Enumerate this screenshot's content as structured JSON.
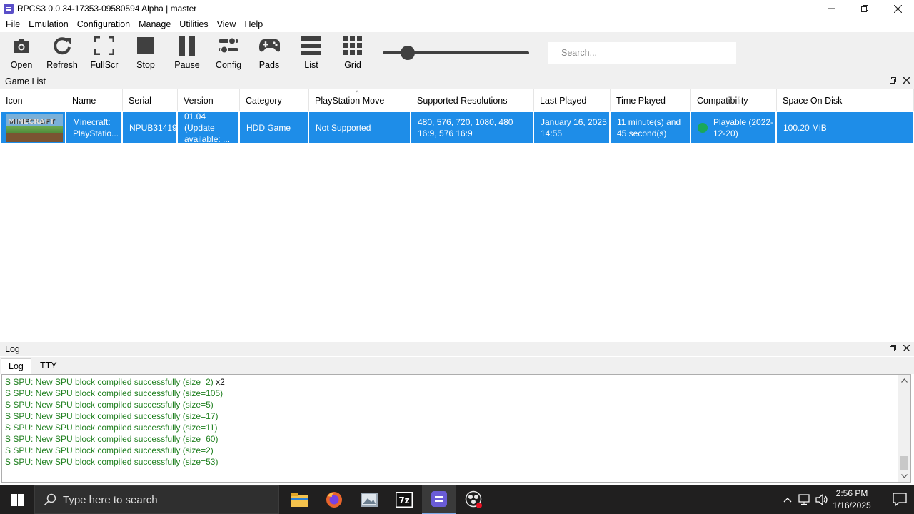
{
  "window": {
    "title": "RPCS3 0.0.34-17353-09580594 Alpha | master",
    "minimize": "—",
    "restore": "❐",
    "close": "✕"
  },
  "menu": [
    "File",
    "Emulation",
    "Configuration",
    "Manage",
    "Utilities",
    "View",
    "Help"
  ],
  "toolbar": {
    "buttons": [
      {
        "label": "Open",
        "icon": "camera-icon"
      },
      {
        "label": "Refresh",
        "icon": "refresh-icon"
      },
      {
        "label": "FullScr",
        "icon": "fullscreen-icon"
      },
      {
        "label": "Stop",
        "icon": "stop-icon"
      },
      {
        "label": "Pause",
        "icon": "pause-icon"
      },
      {
        "label": "Config",
        "icon": "config-icon"
      },
      {
        "label": "Pads",
        "icon": "gamepad-icon"
      },
      {
        "label": "List",
        "icon": "list-icon"
      },
      {
        "label": "Grid",
        "icon": "grid-icon"
      }
    ],
    "icon_size_slider": 0.17,
    "search_placeholder": "Search..."
  },
  "game_list": {
    "title": "Game List",
    "columns": [
      "Icon",
      "Name",
      "Serial",
      "Version",
      "Category",
      "PlayStation Move",
      "Supported Resolutions",
      "Last Played",
      "Time Played",
      "Compatibility",
      "Space On Disk"
    ],
    "sorted_column": "PlayStation Move",
    "rows": [
      {
        "icon_text": "MINECRAFT",
        "name": "Minecraft: PlayStatio...",
        "serial": "NPUB31419",
        "version": "01.04 (Update available: ...",
        "category": "HDD Game",
        "move": "Not Supported",
        "resolutions": "480, 576, 720, 1080, 480 16:9, 576 16:9",
        "last_played": "January 16, 2025 14:55",
        "time_played": "11 minute(s) and 45 second(s)",
        "compatibility": "Playable (2022-12-20)",
        "compat_color": "#1aa85a",
        "size": "100.20 MiB"
      }
    ]
  },
  "log": {
    "title": "Log",
    "tabs": [
      "Log",
      "TTY"
    ],
    "active_tab": "Log",
    "lines": [
      {
        "text": "S SPU: New SPU block compiled successfully (size=2)",
        "suffix": " x2"
      },
      {
        "text": "S SPU: New SPU block compiled successfully (size=105)",
        "suffix": ""
      },
      {
        "text": "S SPU: New SPU block compiled successfully (size=5)",
        "suffix": ""
      },
      {
        "text": "S SPU: New SPU block compiled successfully (size=17)",
        "suffix": ""
      },
      {
        "text": "S SPU: New SPU block compiled successfully (size=11)",
        "suffix": ""
      },
      {
        "text": "S SPU: New SPU block compiled successfully (size=60)",
        "suffix": ""
      },
      {
        "text": "S SPU: New SPU block compiled successfully (size=2)",
        "suffix": ""
      },
      {
        "text": "S SPU: New SPU block compiled successfully (size=53)",
        "suffix": ""
      }
    ],
    "success_color": "#208020"
  },
  "taskbar": {
    "search_placeholder": "Type here to search",
    "apps": [
      "file-explorer-icon",
      "firefox-icon",
      "photos-icon",
      "7zip-icon",
      "rpcs3-icon",
      "obs-icon"
    ],
    "active_app": "rpcs3-icon",
    "time": "2:56 PM",
    "date": "1/16/2025"
  },
  "colors": {
    "selection": "#1e8de8",
    "rpcs3_brand": "#5a4fc8"
  }
}
